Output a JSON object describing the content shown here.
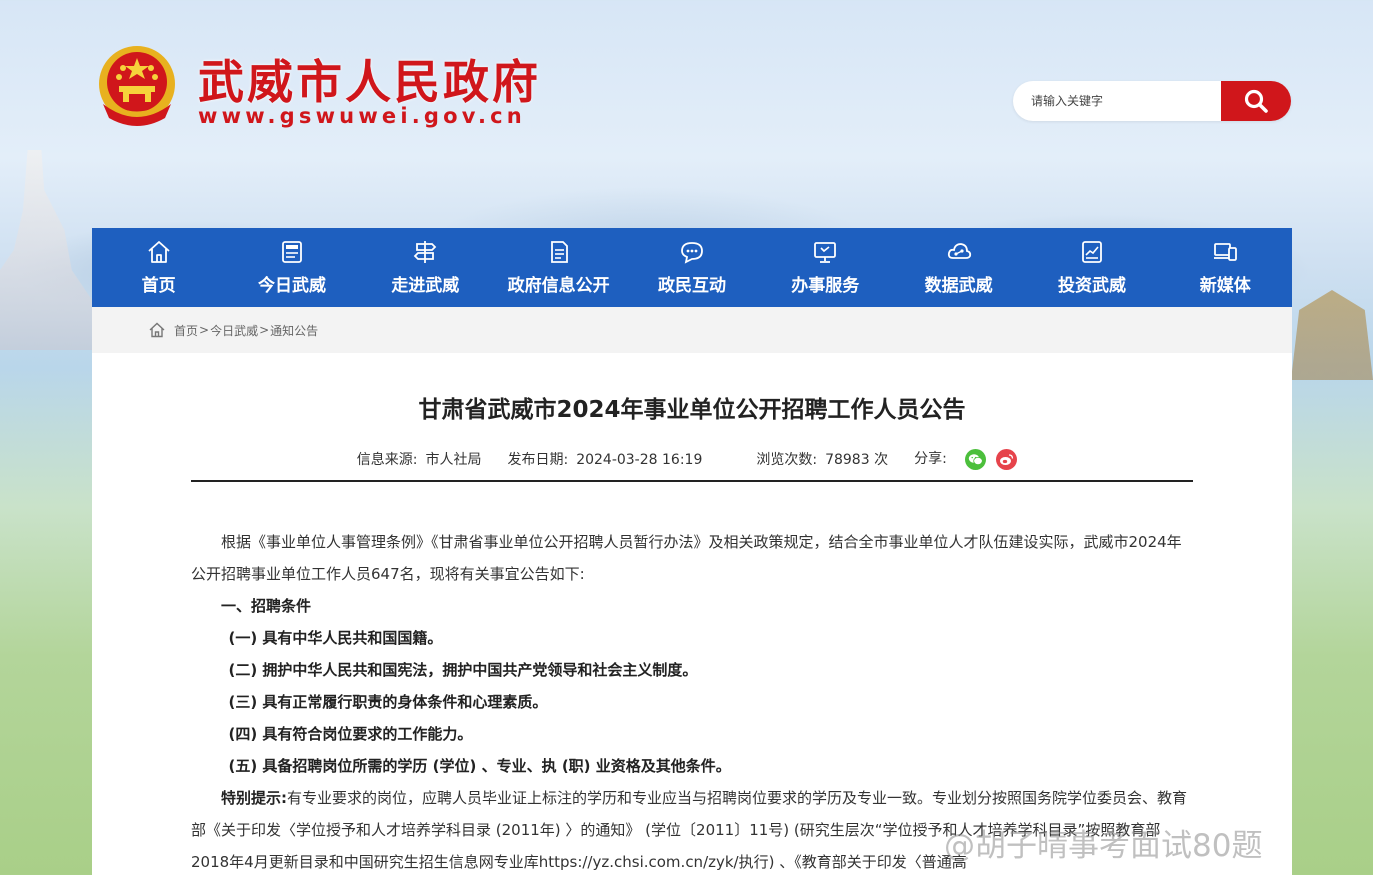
{
  "header": {
    "site_title": "武威市人民政府",
    "site_url": "www.gswuwei.gov.cn",
    "search_placeholder": "请输入关键字"
  },
  "nav": [
    {
      "label": "首页",
      "icon": "home-icon"
    },
    {
      "label": "今日武威",
      "icon": "news-icon"
    },
    {
      "label": "走进武威",
      "icon": "signpost-icon"
    },
    {
      "label": "政府信息公开",
      "icon": "document-icon"
    },
    {
      "label": "政民互动",
      "icon": "chat-icon"
    },
    {
      "label": "办事服务",
      "icon": "monitor-icon"
    },
    {
      "label": "数据武威",
      "icon": "cloud-data-icon"
    },
    {
      "label": "投资武威",
      "icon": "chart-board-icon"
    },
    {
      "label": "新媒体",
      "icon": "devices-icon"
    }
  ],
  "breadcrumb": {
    "items": [
      "首页",
      "今日武威",
      "通知公告"
    ],
    "separator": ">"
  },
  "article": {
    "title": "甘肃省武威市2024年事业单位公开招聘工作人员公告",
    "source_label": "信息来源:",
    "source": "市人社局",
    "date_label": "发布日期:",
    "date": "2024-03-28 16:19",
    "views_label": "浏览次数:",
    "views": "78983 次",
    "share_label": "分享:",
    "paragraphs": {
      "intro": "根据《事业单位人事管理条例》《甘肃省事业单位公开招聘人员暂行办法》及相关政策规定，结合全市事业单位人才队伍建设实际，武威市2024年公开招聘事业单位工作人员647名，现将有关事宜公告如下:",
      "section1": "一、招聘条件",
      "c1": "(一) 具有中华人民共和国国籍。",
      "c2": "(二) 拥护中华人民共和国宪法，拥护中国共产党领导和社会主义制度。",
      "c3": "(三) 具有正常履行职责的身体条件和心理素质。",
      "c4": "(四) 具有符合岗位要求的工作能力。",
      "c5": "(五) 具备招聘岗位所需的学历 (学位) 、专业、执 (职) 业资格及其他条件。",
      "tip_label": "特别提示:",
      "tip_text": "有专业要求的岗位，应聘人员毕业证上标注的学历和专业应当与招聘岗位要求的学历及专业一致。专业划分按照国务院学位委员会、教育部《关于印发〈学位授予和人才培养学科目录 (2011年) 〉的通知》 (学位〔2011〕11号) (研究生层次“学位授予和人才培养学科目录”按照教育部2018年4月更新目录和中国研究生招生信息网专业库https://yz.chsi.com.cn/zyk/执行) 、《教育部关于印发〈普通高"
    }
  },
  "watermark": "@胡子晴事考面试80题",
  "colors": {
    "brand_red": "#d0161b",
    "nav_blue": "#1e5fbf",
    "wechat_green": "#4cbf3c",
    "weibo_red": "#e6434b"
  }
}
